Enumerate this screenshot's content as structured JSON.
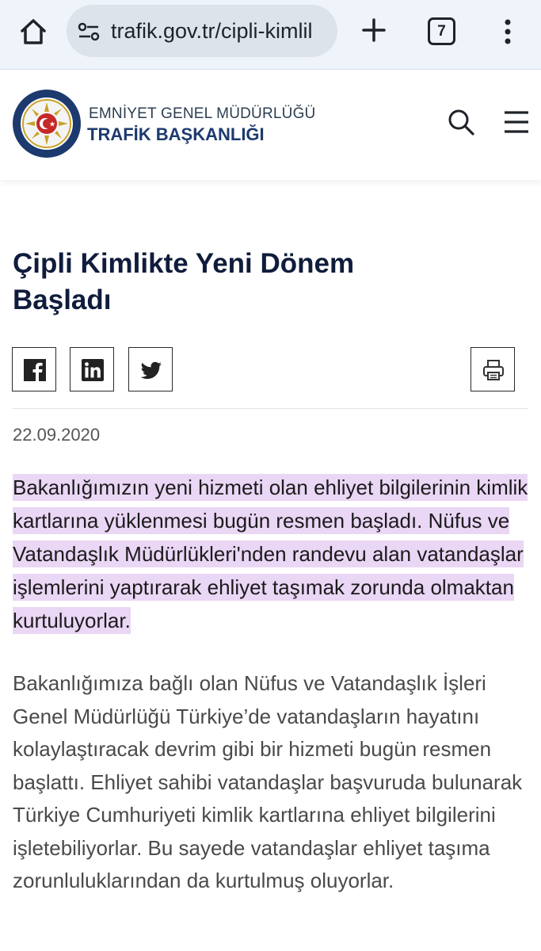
{
  "browser": {
    "url": "trafik.gov.tr/cipli-kimlil",
    "tab_count": "7"
  },
  "header": {
    "org_line1": "EMNİYET GENEL MÜDÜRLÜĞÜ",
    "org_line2": "TRAFİK BAŞKANLIĞI"
  },
  "article": {
    "title": "Çipli Kimlikte Yeni Dönem Başladı",
    "date": "22.09.2020",
    "lead": "Bakanlığımızın yeni hizmeti olan ehliyet bilgilerinin kimlik kartlarına yüklenmesi bugün resmen başladı. Nüfus ve Vatandaşlık Müdürlükleri'nden randevu alan vatandaşlar işlemlerini yaptırarak ehliyet taşımak zorunda olmaktan kurtuluyorlar.",
    "body": "Bakanlığımıza bağlı olan Nüfus ve Vatandaşlık İşleri Genel Müdürlüğü Türkiye’de vatandaşların hayatını kolaylaştıracak devrim gibi bir hizmeti bugün resmen başlattı. Ehliyet sahibi vatandaşlar başvuruda bulunarak Türkiye Cumhuriyeti kimlik kartlarına ehliyet bilgilerini işletebiliyorlar. Bu sayede vatandaşlar ehliyet taşıma zorunluluklarından da kurtulmuş oluyorlar."
  },
  "share_icons": [
    "facebook-icon",
    "linkedin-icon",
    "twitter-icon"
  ],
  "colors": {
    "browser_bar": "#eef4fa",
    "title": "#101c3c",
    "highlight": "#ead6f5",
    "brand_navy": "#1d3a6e"
  }
}
